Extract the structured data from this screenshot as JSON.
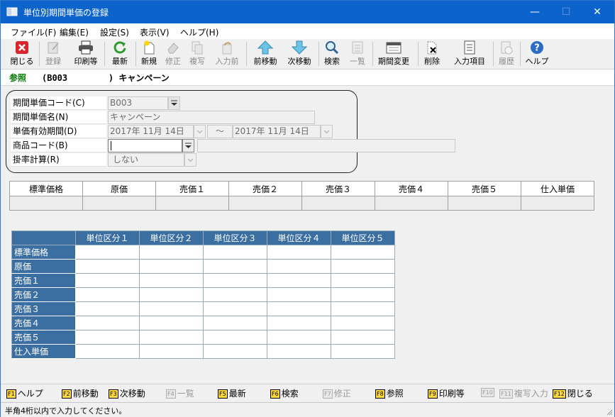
{
  "window": {
    "title": "単位別期間単価の登録",
    "controls": [
      "—",
      "☐",
      "✕"
    ]
  },
  "menu": [
    "ファイル(F)",
    "編集(E)",
    "設定(S)",
    "表示(V)",
    "ヘルプ(H)"
  ],
  "toolbar": [
    {
      "label": "閉じる",
      "icon": "close-icon",
      "enabled": true
    },
    {
      "label": "登録",
      "icon": "register-icon",
      "enabled": false
    },
    {
      "label": "印刷等",
      "icon": "printer-icon",
      "enabled": true
    },
    {
      "label": "最新",
      "icon": "refresh-icon",
      "enabled": true
    },
    {
      "label": "新規",
      "icon": "new-document-icon",
      "enabled": true
    },
    {
      "label": "修正",
      "icon": "eraser-icon",
      "enabled": false
    },
    {
      "label": "複写",
      "icon": "copy-icon",
      "enabled": false
    },
    {
      "label": "入力前",
      "icon": "undo-input-icon",
      "enabled": false
    },
    {
      "label": "前移動",
      "icon": "arrow-up-icon",
      "enabled": true
    },
    {
      "label": "次移動",
      "icon": "arrow-down-icon",
      "enabled": true
    },
    {
      "label": "検索",
      "icon": "search-icon",
      "enabled": true
    },
    {
      "label": "一覧",
      "icon": "list-icon",
      "enabled": false
    },
    {
      "label": "期間変更",
      "icon": "calendar-icon",
      "enabled": true
    },
    {
      "label": "削除",
      "icon": "delete-icon",
      "enabled": true
    },
    {
      "label": "入力項目",
      "icon": "checklist-icon",
      "enabled": true
    },
    {
      "label": "履歴",
      "icon": "history-icon",
      "enabled": false
    },
    {
      "label": "ヘルプ",
      "icon": "help-icon",
      "enabled": true
    }
  ],
  "reference": {
    "label": "参照",
    "value": "(B003        ) キャンペーン"
  },
  "form": {
    "period_price_code": {
      "label": "期間単価コード(C)",
      "value": "B003"
    },
    "period_price_name": {
      "label": "期間単価名(N)",
      "value": "キャンペーン"
    },
    "valid_period": {
      "label": "単価有効期間(D)",
      "from": "2017年 11月 14日",
      "separator": "～",
      "to": "2017年 11月 14日"
    },
    "product_code": {
      "label": "商品コード(B)",
      "value": ""
    },
    "rate_calc": {
      "label": "掛率計算(R)",
      "value": "しない"
    }
  },
  "price_table": {
    "headers": [
      "標準価格",
      "原価",
      "売価１",
      "売価２",
      "売価３",
      "売価４",
      "売価５",
      "仕入単価"
    ],
    "values": [
      "",
      "",
      "",
      "",
      "",
      "",
      "",
      ""
    ]
  },
  "unit_table": {
    "columns": [
      "単位区分１",
      "単位区分２",
      "単位区分３",
      "単位区分４",
      "単位区分５"
    ],
    "rows": [
      "標準価格",
      "原価",
      "売価１",
      "売価２",
      "売価３",
      "売価４",
      "売価５",
      "仕入単価"
    ]
  },
  "function_keys": [
    {
      "key": "F1",
      "label": "ヘルプ",
      "enabled": true
    },
    {
      "key": "F2",
      "label": "前移動",
      "enabled": true
    },
    {
      "key": "F3",
      "label": "次移動",
      "enabled": true
    },
    {
      "key": "F4",
      "label": "一覧",
      "enabled": false
    },
    {
      "key": "F5",
      "label": "最新",
      "enabled": true
    },
    {
      "key": "F6",
      "label": "検索",
      "enabled": true
    },
    {
      "key": "F7",
      "label": "修正",
      "enabled": false
    },
    {
      "key": "F8",
      "label": "参照",
      "enabled": true
    },
    {
      "key": "F9",
      "label": "印刷等",
      "enabled": true
    },
    {
      "key": "F10",
      "label": "",
      "enabled": false
    },
    {
      "key": "F11",
      "label": "複写入力",
      "enabled": false
    },
    {
      "key": "F12",
      "label": "閉じる",
      "enabled": true
    }
  ],
  "status": "半角4桁以内で入力してください。",
  "colors": {
    "titlebar": "#0b63cb",
    "table_header": "#3b6fa2",
    "reference_label": "#0a7a0a",
    "fkey_badge": "#ffd83d"
  }
}
